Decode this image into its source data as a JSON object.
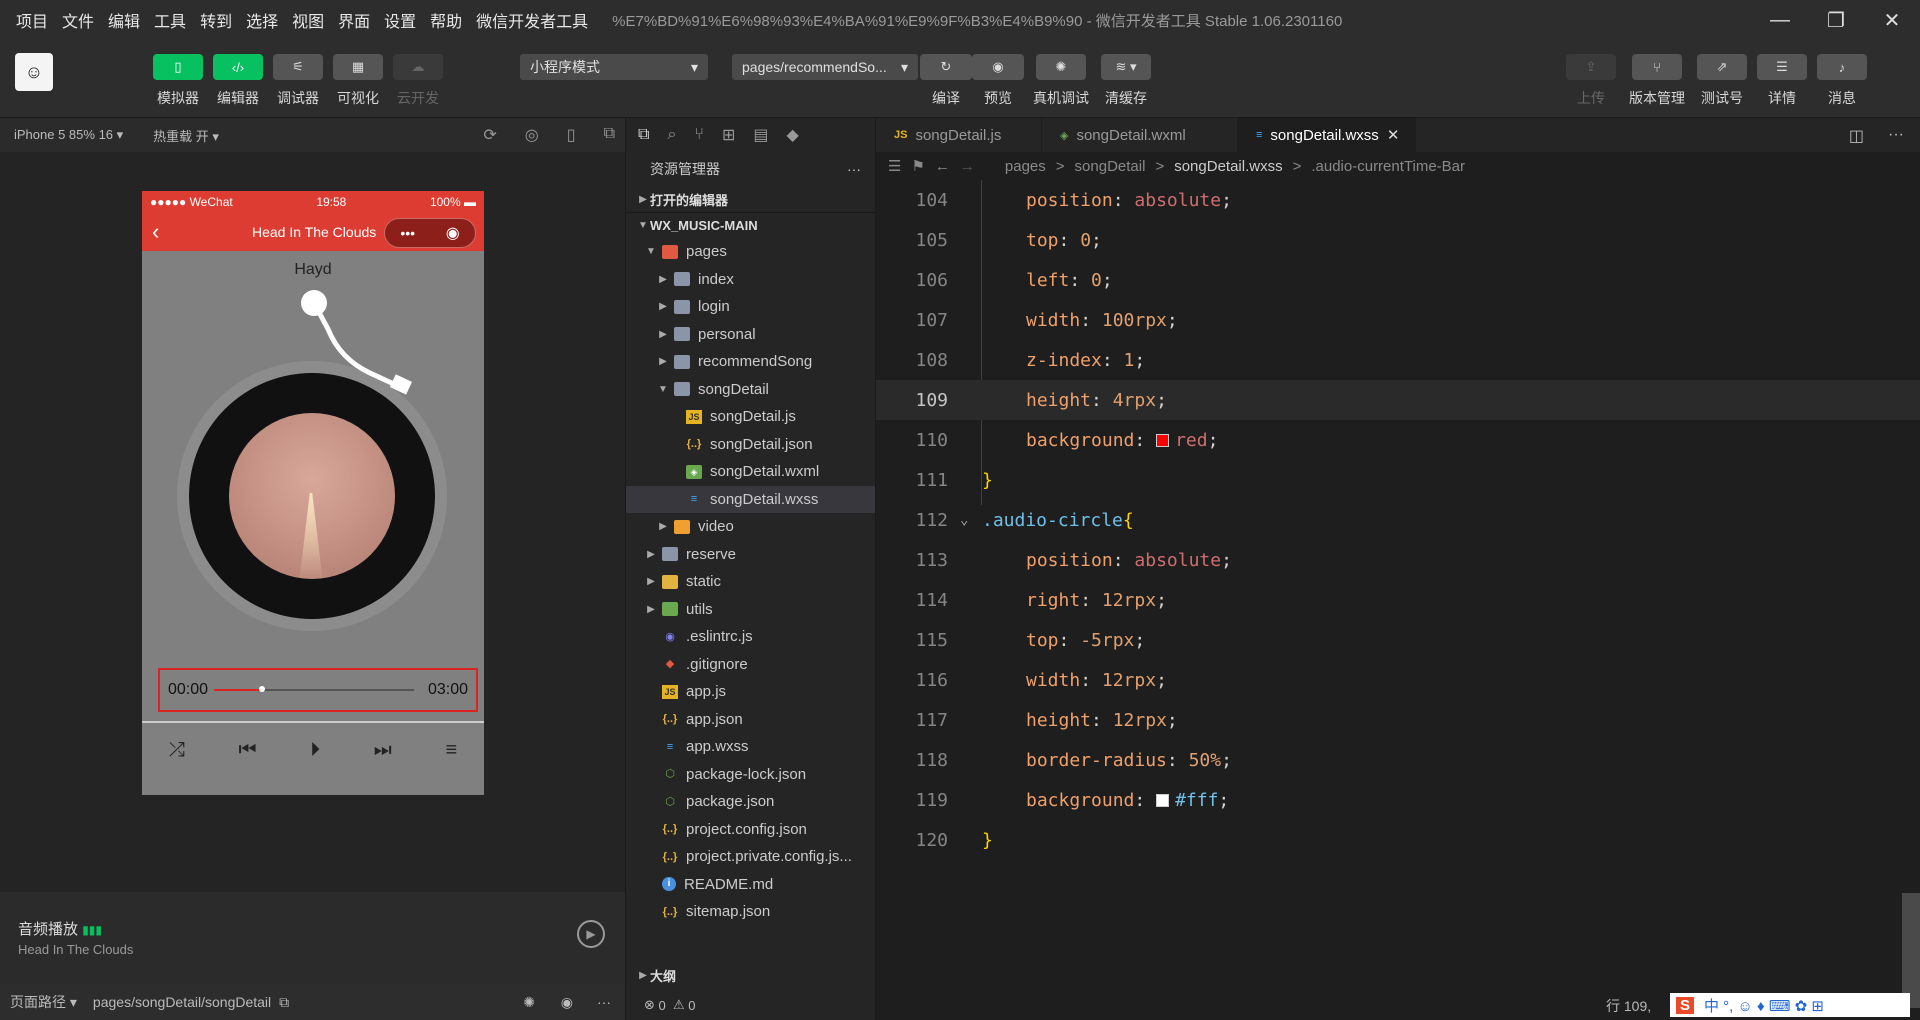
{
  "menu": {
    "items": [
      "项目",
      "文件",
      "编辑",
      "工具",
      "转到",
      "选择",
      "视图",
      "界面",
      "设置",
      "帮助",
      "微信开发者工具"
    ],
    "window_title": "%E7%BD%91%E6%98%93%E4%BA%91%E9%9F%B3%E4%B9%90 - 微信开发者工具 Stable 1.06.2301160"
  },
  "toolbar": {
    "simulator": "模拟器",
    "editor": "编辑器",
    "debugger": "调试器",
    "visual": "可视化",
    "cloud": "云开发",
    "mode": "小程序模式",
    "page_path": "pages/recommendSo...",
    "compile": "编译",
    "preview": "预览",
    "real_debug": "真机调试",
    "clear_cache": "清缓存",
    "upload": "上传",
    "version": "版本管理",
    "test": "测试号",
    "details": "详情",
    "messages": "消息"
  },
  "simulator": {
    "device": "iPhone 5 85% 16",
    "hot_reload": "热重载 开",
    "status_carrier": "●●●●● WeChat",
    "status_time": "19:58",
    "status_battery": "100%",
    "nav_title": "Head In The Clouds",
    "author": "Hayd",
    "time_current": "00:00",
    "time_total": "03:00",
    "progress_fraction": 0.24
  },
  "audio": {
    "title": "音频播放",
    "song": "Head In The Clouds"
  },
  "pathbar": {
    "label": "页面路径",
    "path": "pages/songDetail/songDetail"
  },
  "explorer": {
    "title": "资源管理器",
    "open_editors": "打开的编辑器",
    "project": "WX_MUSIC-MAIN",
    "outline": "大纲",
    "errors": "0",
    "warnings": "0",
    "tree": [
      {
        "name": "pages",
        "depth": 1,
        "arrow": "▼",
        "icon": "folder red"
      },
      {
        "name": "index",
        "depth": 2,
        "arrow": "▶",
        "icon": "folder"
      },
      {
        "name": "login",
        "depth": 2,
        "arrow": "▶",
        "icon": "folder"
      },
      {
        "name": "personal",
        "depth": 2,
        "arrow": "▶",
        "icon": "folder"
      },
      {
        "name": "recommendSong",
        "depth": 2,
        "arrow": "▶",
        "icon": "folder"
      },
      {
        "name": "songDetail",
        "depth": 2,
        "arrow": "▼",
        "icon": "folder"
      },
      {
        "name": "songDetail.js",
        "depth": 3,
        "arrow": "",
        "icon": "fjs"
      },
      {
        "name": "songDetail.json",
        "depth": 3,
        "arrow": "",
        "icon": "fjson"
      },
      {
        "name": "songDetail.wxml",
        "depth": 3,
        "arrow": "",
        "icon": "fwxml"
      },
      {
        "name": "songDetail.wxss",
        "depth": 3,
        "arrow": "",
        "icon": "fwxss",
        "selected": true
      },
      {
        "name": "video",
        "depth": 2,
        "arrow": "▶",
        "icon": "folder orange"
      },
      {
        "name": "reserve",
        "depth": 1,
        "arrow": "▶",
        "icon": "folder"
      },
      {
        "name": "static",
        "depth": 1,
        "arrow": "▶",
        "icon": "folder yellow"
      },
      {
        "name": "utils",
        "depth": 1,
        "arrow": "▶",
        "icon": "folder greenf"
      },
      {
        "name": ".eslintrc.js",
        "depth": 1,
        "arrow": "",
        "icon": "feslint"
      },
      {
        "name": ".gitignore",
        "depth": 1,
        "arrow": "",
        "icon": "fgit"
      },
      {
        "name": "app.js",
        "depth": 1,
        "arrow": "",
        "icon": "fjs"
      },
      {
        "name": "app.json",
        "depth": 1,
        "arrow": "",
        "icon": "fjson"
      },
      {
        "name": "app.wxss",
        "depth": 1,
        "arrow": "",
        "icon": "fwxss"
      },
      {
        "name": "package-lock.json",
        "depth": 1,
        "arrow": "",
        "icon": "fnode"
      },
      {
        "name": "package.json",
        "depth": 1,
        "arrow": "",
        "icon": "fnode"
      },
      {
        "name": "project.config.json",
        "depth": 1,
        "arrow": "",
        "icon": "fjson"
      },
      {
        "name": "project.private.config.js...",
        "depth": 1,
        "arrow": "",
        "icon": "fjson"
      },
      {
        "name": "README.md",
        "depth": 1,
        "arrow": "",
        "icon": "finfo"
      },
      {
        "name": "sitemap.json",
        "depth": 1,
        "arrow": "",
        "icon": "fjson"
      }
    ]
  },
  "editor": {
    "tabs": [
      {
        "name": "songDetail.js",
        "icon": "JS",
        "color": "#e6b422"
      },
      {
        "name": "songDetail.wxml",
        "icon": "◈",
        "color": "#6aa84f"
      },
      {
        "name": "songDetail.wxss",
        "icon": "≡",
        "color": "#42a5f5",
        "active": true
      }
    ],
    "breadcrumbs": [
      "pages",
      ">",
      "songDetail",
      ">",
      "songDetail.wxss",
      ">",
      ".audio-currentTime-Bar"
    ],
    "cursor_status": "行 109,",
    "lines": [
      {
        "num": "104",
        "prop": "position",
        "val": "absolute"
      },
      {
        "num": "105",
        "prop": "top",
        "val": "0"
      },
      {
        "num": "106",
        "prop": "left",
        "val": "0"
      },
      {
        "num": "107",
        "prop": "width",
        "val": "100rpx"
      },
      {
        "num": "108",
        "prop": "z-index",
        "val": "1"
      },
      {
        "num": "109",
        "prop": "height",
        "val": "4rpx",
        "current": true
      },
      {
        "num": "110",
        "prop": "background",
        "val": "red",
        "swatch": "#ff0000"
      },
      {
        "num": "111",
        "close": "}"
      },
      {
        "num": "112",
        "selector": ".audio-circle"
      },
      {
        "num": "113",
        "prop": "position",
        "val": "absolute"
      },
      {
        "num": "114",
        "prop": "right",
        "val": "12rpx"
      },
      {
        "num": "115",
        "prop": "top",
        "val": "-5rpx"
      },
      {
        "num": "116",
        "prop": "width",
        "val": "12rpx"
      },
      {
        "num": "117",
        "prop": "height",
        "val": "12rpx"
      },
      {
        "num": "118",
        "prop": "border-radius",
        "val": "50%"
      },
      {
        "num": "119",
        "prop": "background",
        "val": "#fff",
        "swatch": "#ffffff"
      },
      {
        "num": "120",
        "close": "}"
      }
    ]
  },
  "ime": "中 °, ☺ ♦ ⌨ ✿ ⊞"
}
